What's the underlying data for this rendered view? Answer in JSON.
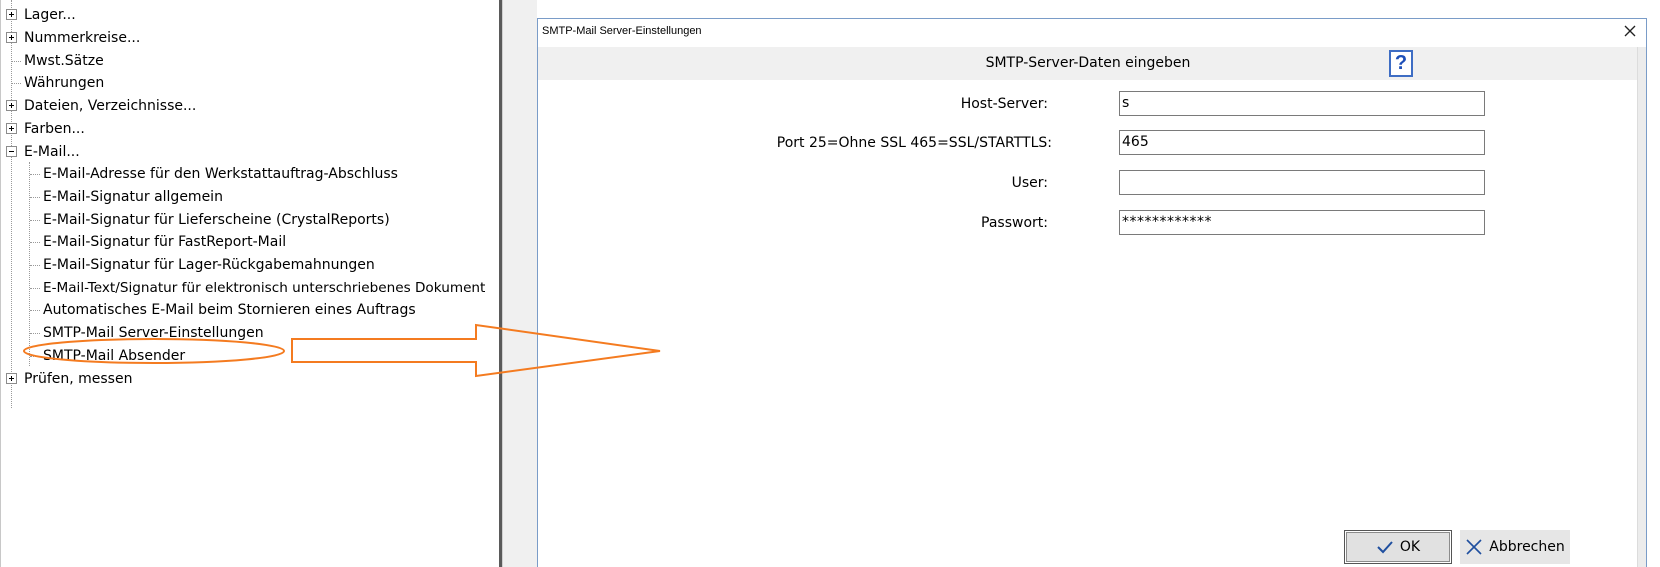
{
  "tree": {
    "items": [
      {
        "label": "Lager...",
        "expander": "plus"
      },
      {
        "label": "Nummerkreise...",
        "expander": "plus"
      },
      {
        "label": "Mwst.Sätze",
        "expander": "none"
      },
      {
        "label": "Währungen",
        "expander": "none"
      },
      {
        "label": "Dateien, Verzeichnisse...",
        "expander": "plus"
      },
      {
        "label": "Farben...",
        "expander": "plus"
      },
      {
        "label": "E-Mail...",
        "expander": "minus"
      },
      {
        "label": "E-Mail-Adresse für den Werkstattauftrag-Abschluss",
        "expander": "none"
      },
      {
        "label": "E-Mail-Signatur allgemein",
        "expander": "none"
      },
      {
        "label": "E-Mail-Signatur für Lieferscheine (CrystalReports)",
        "expander": "none"
      },
      {
        "label": "E-Mail-Signatur für FastReport-Mail",
        "expander": "none"
      },
      {
        "label": "E-Mail-Signatur für Lager-Rückgabemahnungen",
        "expander": "none"
      },
      {
        "label": "E-Mail-Text/Signatur für elektronisch unterschriebenes Dokument",
        "expander": "none"
      },
      {
        "label": "Automatisches E-Mail beim Stornieren eines Auftrags",
        "expander": "none"
      },
      {
        "label": "SMTP-Mail Server-Einstellungen",
        "expander": "none",
        "highlighted": true
      },
      {
        "label": "SMTP-Mail Absender",
        "expander": "none"
      },
      {
        "label": "Prüfen, messen",
        "expander": "plus"
      }
    ]
  },
  "dialog": {
    "title": "SMTP-Mail Server-Einstellungen",
    "heading": "SMTP-Server-Daten eingeben",
    "help_icon": "?",
    "fields": {
      "host_label": "Host-Server:",
      "host_value": "s",
      "port_label": "Port 25=Ohne SSL  465=SSL/STARTTLS:",
      "port_value": "465",
      "user_label": "User:",
      "user_value": "",
      "password_label": "Passwort:",
      "password_value": "************"
    },
    "buttons": {
      "ok_label": "OK",
      "cancel_label": "Abbrechen"
    }
  },
  "colors": {
    "annotation_orange": "#f47b20",
    "help_blue": "#1d4fb8",
    "dialog_border": "#7a9cc8"
  },
  "icons": {
    "close": "close-icon",
    "help": "help-icon",
    "ok": "checkmark-icon",
    "cancel": "x-icon",
    "expander": "tree-expander-icon"
  }
}
